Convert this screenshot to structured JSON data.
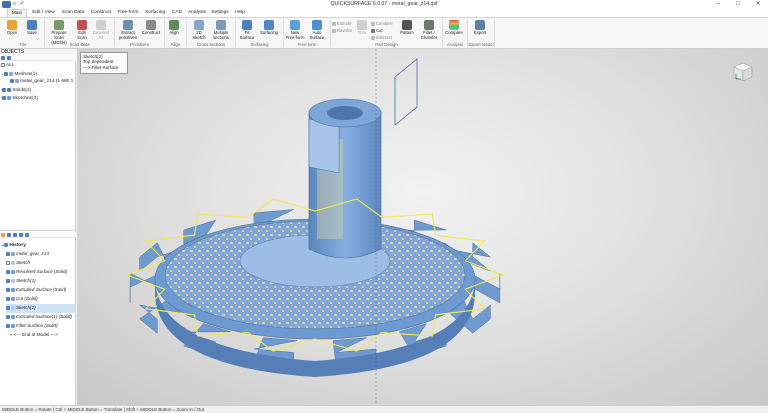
{
  "window": {
    "title": "QUICKSURFACE 6.0.07 - metal_gear_z14.qsf",
    "quick_access": [
      "≡",
      "↶"
    ],
    "controls": {
      "minimize": "–",
      "maximize": "□",
      "close": "✕"
    }
  },
  "tabs": [
    {
      "label": "Main",
      "active": true
    },
    {
      "label": "Edit / View",
      "active": false
    },
    {
      "label": "Scan Data",
      "active": false
    },
    {
      "label": "Construct",
      "active": false
    },
    {
      "label": "Free-form",
      "active": false
    },
    {
      "label": "Surfacing",
      "active": false
    },
    {
      "label": "CAD",
      "active": false
    },
    {
      "label": "Analysis",
      "active": false
    },
    {
      "label": "Settings",
      "active": false
    },
    {
      "label": "Help",
      "active": false
    }
  ],
  "ribbon": {
    "buttons": [
      {
        "label": "Open",
        "icon": "folder-icon",
        "color": "#e6a23c"
      },
      {
        "label": "Save",
        "icon": "save-icon",
        "color": "#4a7fc1"
      },
      {
        "label": "Prepare Scan (MESH)",
        "icon": "prepare-scan-icon",
        "color": "#7a9a6a"
      },
      {
        "label": "Edit Scan",
        "icon": "edit-scan-icon",
        "color": "#c0504d"
      },
      {
        "label": "Deselect All",
        "icon": "deselect-icon",
        "color": "#b9b9b9",
        "disabled": true
      },
      {
        "label": "Extract primitives",
        "icon": "extract-primitives-icon",
        "color": "#6f8fb5"
      },
      {
        "label": "Construct",
        "icon": "construct-icon",
        "color": "#8a8a8a"
      },
      {
        "label": "Align",
        "icon": "align-icon",
        "color": "#5b8c5a"
      },
      {
        "label": "2D Sketch",
        "icon": "sketch-2d-icon",
        "color": "#8aa6c9"
      },
      {
        "label": "Multiple sections",
        "icon": "sections-icon",
        "color": "#7f9ab8"
      },
      {
        "label": "Fit Surface",
        "icon": "fit-surface-icon",
        "color": "#4c7ec0"
      },
      {
        "label": "Surfacing",
        "icon": "surfacing-icon",
        "color": "#4f86c6"
      },
      {
        "label": "New Free-form",
        "icon": "freeform-icon",
        "color": "#5aa0d8"
      },
      {
        "label": "Auto Surface",
        "icon": "auto-surface-icon",
        "color": "#4f8ed0"
      },
      {
        "label": "Trim",
        "icon": "trim-icon",
        "color": "#b0b0b0",
        "disabled": true
      },
      {
        "label": "Pattern",
        "icon": "pattern-icon",
        "color": "#555555"
      },
      {
        "label": "Fillet / Chamfer",
        "icon": "fillet-icon",
        "color": "#6a7a6a"
      },
      {
        "label": "Compare",
        "icon": "compare-icon",
        "color": "#d9534f"
      },
      {
        "label": "Export",
        "icon": "export-icon",
        "color": "#5f7fa8"
      }
    ],
    "small_items": [
      {
        "label": "Extrude",
        "icon": "extrude-icon"
      },
      {
        "label": "Revolve",
        "icon": "revolve-icon"
      },
      {
        "label": "Combine",
        "icon": "combine-icon"
      },
      {
        "label": "Cut",
        "icon": "cut-icon"
      },
      {
        "label": "Intersect",
        "icon": "intersect-icon"
      }
    ],
    "groups": [
      "File",
      "Scan Data",
      "Primitives",
      "Align",
      "Cross sections",
      "Surfacing",
      "Free-form",
      "Part Design",
      "Analysis",
      "Export Model"
    ]
  },
  "objects_panel": {
    "title": "OBJECTS",
    "items": [
      {
        "label": "ALL",
        "icon": "checkbox-icon",
        "color": "#ffffff"
      },
      {
        "label": "Meshes(1)",
        "icon": "mesh-icon",
        "color": "#4a7fc1"
      },
      {
        "label": "metal_gear_z14 (1 660 1",
        "icon": "mesh-item-icon",
        "color": "#4a7fc1"
      },
      {
        "label": "Solids(1)",
        "icon": "solid-icon",
        "color": "#4a7fc1"
      },
      {
        "label": "Sketches(3)",
        "icon": "sketch-icon",
        "color": "#4a7fc1"
      }
    ]
  },
  "history_panel": {
    "title": "History",
    "items": [
      {
        "label": "metal_gear_z14",
        "color": "#4a7fc1",
        "selected": false
      },
      {
        "label": "Sketch",
        "color": "#ffffff",
        "selected": false
      },
      {
        "label": "Revolved-Surface (Solid)",
        "color": "#4a7fc1",
        "selected": false
      },
      {
        "label": "Sketch(1)",
        "color": "#4a7fc1",
        "selected": false
      },
      {
        "label": "Extruded-Surface (Solid)",
        "color": "#4a7fc1",
        "selected": false
      },
      {
        "label": "Cut (Solid)",
        "color": "#4a7fc1",
        "selected": false
      },
      {
        "label": "Sketch(2)",
        "color": "#4a7fc1",
        "selected": true
      },
      {
        "label": "Extruded-Surface(1) (Solid)",
        "color": "#4a7fc1",
        "selected": false
      },
      {
        "label": "Fillet-Surface (Solid)",
        "color": "#4a7fc1",
        "selected": false
      },
      {
        "label": "<--- End of Model --->",
        "color": "#e08a2e",
        "selected": false
      }
    ]
  },
  "tooltip": {
    "line1": "Sketch(2)",
    "line2": "Top dependent",
    "line3": "---> Fillet-Surface"
  },
  "statusbar": {
    "text": "MIDDLE Button = Rotate | Ctrl + MIDDLE Button = Translate | Shift + MIDDLE Button = Zoom In / Out"
  },
  "colors": {
    "model_blue": "#6e9ed6",
    "model_scan": "#d6cfa6",
    "sketch_yellow": "#f2e94e",
    "sketch_blue": "#4a6fb0"
  }
}
